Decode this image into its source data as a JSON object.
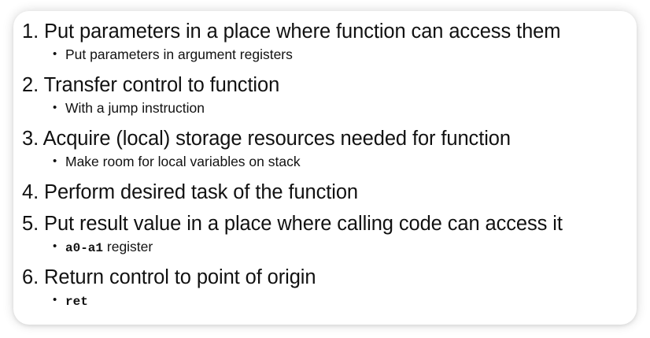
{
  "steps": [
    {
      "title": "1. Put parameters in a place where function can access them",
      "sub": "Put parameters in argument registers"
    },
    {
      "title": "2. Transfer control to function",
      "sub": "With a jump instruction"
    },
    {
      "title": "3. Acquire (local) storage resources needed for function",
      "sub": "Make room for local variables on stack"
    },
    {
      "title": "4. Perform desired task of the function"
    },
    {
      "title": "5. Put result value in a place where calling code can access it",
      "sub_code": "a0-a1",
      "sub_text": " register"
    },
    {
      "title": "6. Return control to point of origin",
      "sub_code": "ret"
    }
  ],
  "bullet_glyph": "•"
}
